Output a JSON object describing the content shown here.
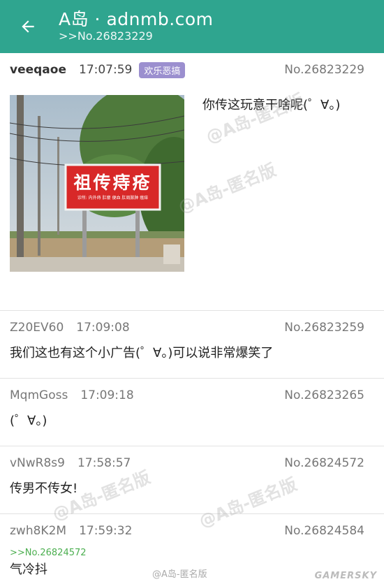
{
  "appbar": {
    "title": "A岛 · adnmb.com",
    "subtitle": ">>No.26823229",
    "back_icon": "arrow-left-icon"
  },
  "op": {
    "uid": "veeqaoe",
    "time": "17:07:59",
    "tag": "欢乐恶搞",
    "no": "No.26823229",
    "text": "你传这玩意干啥呢(゜∀。)",
    "sign_text": "祖传痔疮",
    "sign_small": "诊所: 内外痔 肛瘘 便血 肛周脓肿 瘙痒"
  },
  "replies": [
    {
      "uid": "Z20EV60",
      "time": "17:09:08",
      "no": "No.26823259",
      "ref": "",
      "text": "我们这也有这个小广告(゜∀。)可以说非常爆笑了"
    },
    {
      "uid": "MqmGoss",
      "time": "17:09:18",
      "no": "No.26823265",
      "ref": "",
      "text": "(゜∀。)"
    },
    {
      "uid": "vNwR8s9",
      "time": "17:58:57",
      "no": "No.26824572",
      "ref": "",
      "text": "传男不传女!"
    },
    {
      "uid": "zwh8K2M",
      "time": "17:59:32",
      "no": "No.26824584",
      "ref": ">>No.26824572",
      "text": "气冷抖"
    }
  ],
  "watermarks": [
    "@A岛-匿名版",
    "@A岛-匿名版",
    "@A岛-匿名版",
    "@A岛-匿名版"
  ],
  "footer": {
    "weibo": "@A岛-匿名版",
    "brand": "GAMERSKY"
  },
  "colors": {
    "appbar": "#2fa58f",
    "tag": "#9b8fcf",
    "reply_ref": "#4caf50"
  }
}
